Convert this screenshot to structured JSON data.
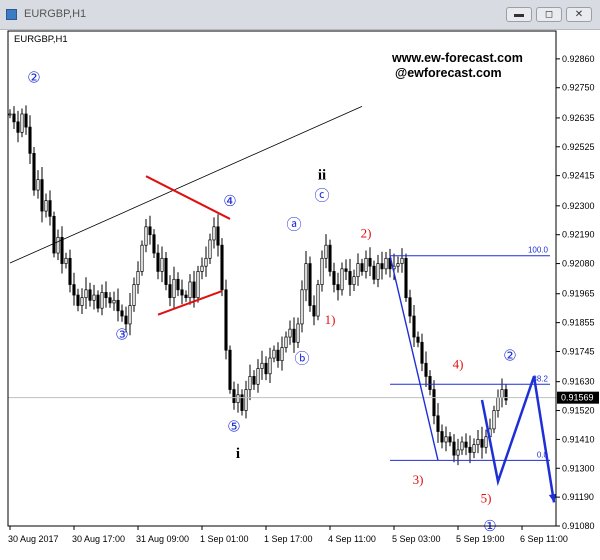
{
  "window": {
    "title": "EURGBP,H1",
    "buttons": {
      "minimize": "▬",
      "restore": "◻",
      "close": "✕"
    }
  },
  "header": {
    "symbol": "EURGBP,H1",
    "site": "www.ew-forecast.com",
    "handle": "@ewforecast.com"
  },
  "chart_data": {
    "type": "candlestick",
    "symbol": "EURGBP",
    "timeframe": "H1",
    "grid": false,
    "colors": {
      "background": "#ffffff",
      "candle": "#000000",
      "wave_blue": "#1f2fd6",
      "wave_red": "#e01010",
      "trendline": "#000000",
      "triangle": "#e01010",
      "fib": "#1f2fd6"
    },
    "ylim": [
      0.9108,
      0.9297
    ],
    "y_ticks": [
      "0.92860",
      "0.92750",
      "0.92635",
      "0.92525",
      "0.92415",
      "0.92300",
      "0.92190",
      "0.92080",
      "0.91965",
      "0.91855",
      "0.91745",
      "0.91630",
      "0.91520",
      "0.91410",
      "0.91300",
      "0.91190",
      "0.91080"
    ],
    "x_ticks": [
      {
        "label": "30 Aug 2017",
        "bar": 0
      },
      {
        "label": "30 Aug 17:00",
        "bar": 16
      },
      {
        "label": "31 Aug 09:00",
        "bar": 32
      },
      {
        "label": "1 Sep 01:00",
        "bar": 48
      },
      {
        "label": "1 Sep 17:00",
        "bar": 64
      },
      {
        "label": "4 Sep 11:00",
        "bar": 80
      },
      {
        "label": "5 Sep 03:00",
        "bar": 96
      },
      {
        "label": "5 Sep 19:00",
        "bar": 112
      },
      {
        "label": "6 Sep 11:00",
        "bar": 128
      }
    ],
    "current_price": "0.91569",
    "current_value": 0.91569,
    "keyprice": [
      0.9265,
      0.9262,
      0.9258,
      0.9265,
      0.926,
      0.925,
      0.9236,
      0.924,
      0.9228,
      0.9232,
      0.9226,
      0.9212,
      0.9218,
      0.9208,
      0.921,
      0.92,
      0.9196,
      0.9192,
      0.9195,
      0.9198,
      0.9194,
      0.9196,
      0.9191,
      0.9197,
      0.9195,
      0.9193,
      0.9194,
      0.919,
      0.9188,
      0.9185,
      0.9192,
      0.92,
      0.9205,
      0.9215,
      0.9222,
      0.9219,
      0.9212,
      0.9205,
      0.921,
      0.92,
      0.9195,
      0.9202,
      0.9198,
      0.9196,
      0.9195,
      0.9201,
      0.9195,
      0.9205,
      0.9207,
      0.921,
      0.9217,
      0.9222,
      0.9215,
      0.9198,
      0.9175,
      0.916,
      0.9155,
      0.9158,
      0.9152,
      0.916,
      0.9165,
      0.9162,
      0.9168,
      0.917,
      0.9166,
      0.9172,
      0.9175,
      0.9171,
      0.9176,
      0.918,
      0.9183,
      0.9178,
      0.9185,
      0.9198,
      0.9208,
      0.9192,
      0.9188,
      0.92,
      0.921,
      0.9215,
      0.9205,
      0.92,
      0.9198,
      0.9206,
      0.9205,
      0.92,
      0.9203,
      0.9208,
      0.9205,
      0.921,
      0.9207,
      0.9202,
      0.9208,
      0.9206,
      0.921,
      0.9206,
      0.9207,
      0.9208,
      0.921,
      0.9195,
      0.9188,
      0.918,
      0.9178,
      0.917,
      0.9165,
      0.916,
      0.915,
      0.9144,
      0.914,
      0.9142,
      0.914,
      0.9135,
      0.9137,
      0.914,
      0.9138,
      0.9136,
      0.9139,
      0.9141,
      0.9138,
      0.9142,
      0.9145,
      0.9152,
      0.9157,
      0.916,
      0.9156
    ],
    "trendline": [
      {
        "bar": 0,
        "price": 0.92082
      },
      {
        "bar": 88,
        "price": 0.92679
      }
    ],
    "triangle": [
      {
        "bar": 34,
        "price": 0.92413
      },
      {
        "bar": 55,
        "price": 0.9225
      },
      {
        "bar": 37,
        "price": 0.91885
      },
      {
        "bar": 53,
        "price": 0.91975
      }
    ],
    "fib_lines": [
      {
        "label": "100.0",
        "price": 0.9211,
        "bar_from": 95,
        "bar_to": 135
      },
      {
        "label": "38.2",
        "price": 0.9162,
        "bar_from": 95,
        "bar_to": 135
      },
      {
        "label": "0.0",
        "price": 0.9133,
        "bar_from": 95,
        "bar_to": 135
      }
    ],
    "projection": [
      {
        "bar": 118,
        "price": 0.9156
      },
      {
        "bar": 122,
        "price": 0.9125
      },
      {
        "bar": 131,
        "price": 0.9165
      },
      {
        "bar": 136,
        "price": 0.9117
      }
    ],
    "wave_labels": [
      {
        "text": "②",
        "bar": 6,
        "price": 0.9277,
        "style": "blue"
      },
      {
        "text": "③",
        "bar": 28,
        "price": 0.9179,
        "style": "blue"
      },
      {
        "text": "④",
        "bar": 55,
        "price": 0.923,
        "style": "blue"
      },
      {
        "text": "⑤",
        "bar": 56,
        "price": 0.9144,
        "style": "blue"
      },
      {
        "text": "i",
        "bar": 57,
        "price": 0.9134,
        "style": "black"
      },
      {
        "text": "ⓐ",
        "bar": 71,
        "price": 0.9221,
        "style": "blue"
      },
      {
        "text": "ⓑ",
        "bar": 73,
        "price": 0.917,
        "style": "blue"
      },
      {
        "text": "ii",
        "bar": 78,
        "price": 0.924,
        "style": "black"
      },
      {
        "text": "ⓒ",
        "bar": 78,
        "price": 0.9232,
        "style": "blue"
      },
      {
        "text": "2)",
        "bar": 89,
        "price": 0.9218,
        "style": "red"
      },
      {
        "text": "1)",
        "bar": 80,
        "price": 0.9185,
        "style": "red"
      },
      {
        "text": "3)",
        "bar": 102,
        "price": 0.9124,
        "style": "red"
      },
      {
        "text": "4)",
        "bar": 112,
        "price": 0.9168,
        "style": "red"
      },
      {
        "text": "5)",
        "bar": 119,
        "price": 0.9117,
        "style": "red"
      },
      {
        "text": "①",
        "bar": 120,
        "price": 0.9106,
        "style": "blue"
      },
      {
        "text": "②",
        "bar": 125,
        "price": 0.9171,
        "style": "blue"
      }
    ]
  }
}
